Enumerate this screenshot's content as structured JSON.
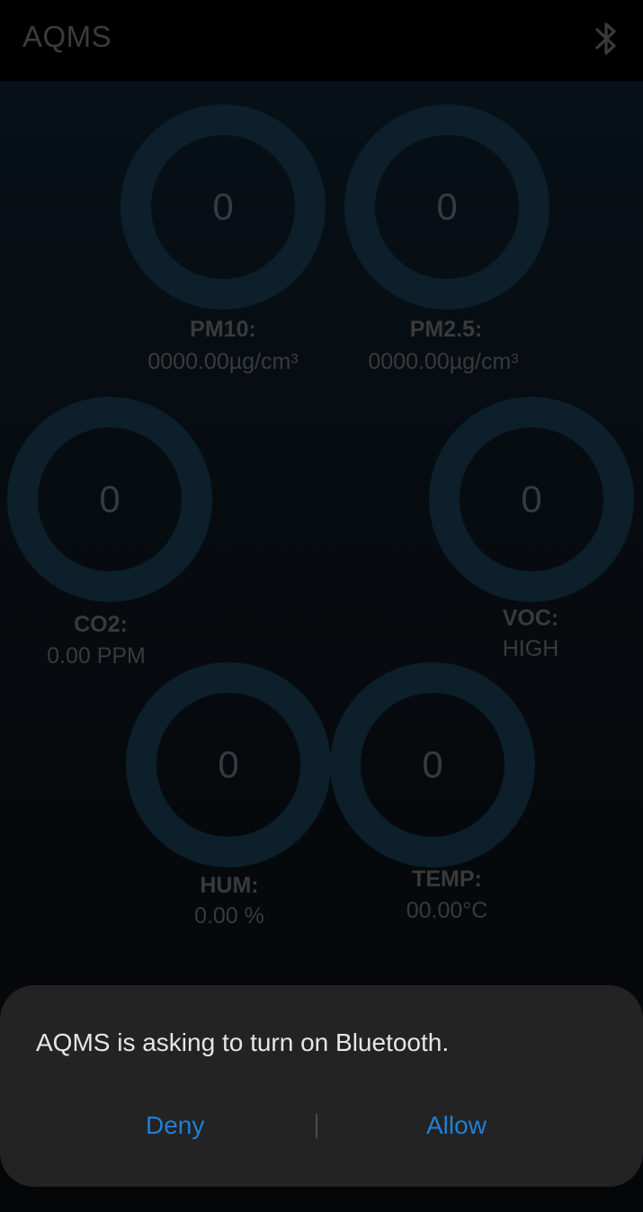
{
  "app_bar": {
    "title": "AQMS",
    "bluetooth_icon": "bluetooth-icon"
  },
  "gauges": {
    "pm10": {
      "value": "0",
      "label": "PM10:",
      "reading": "0000.00µg/cm³"
    },
    "pm25": {
      "value": "0",
      "label": "PM2.5:",
      "reading": "0000.00µg/cm³"
    },
    "co2": {
      "value": "0",
      "label": "CO2:",
      "reading": "0.00 PPM"
    },
    "voc": {
      "value": "0",
      "label": "VOC:",
      "reading": "HIGH"
    },
    "hum": {
      "value": "0",
      "label": "HUM:",
      "reading": "0.00 %"
    },
    "temp": {
      "value": "0",
      "label": "TEMP:",
      "reading": "00.00°C"
    }
  },
  "dialog": {
    "message": "AQMS is asking to turn on Bluetooth.",
    "deny_label": "Deny",
    "allow_label": "Allow"
  },
  "colors": {
    "gauge_ring": "#0c1f2b",
    "dialog_background": "#232323",
    "accent": "#1f7fd6"
  }
}
